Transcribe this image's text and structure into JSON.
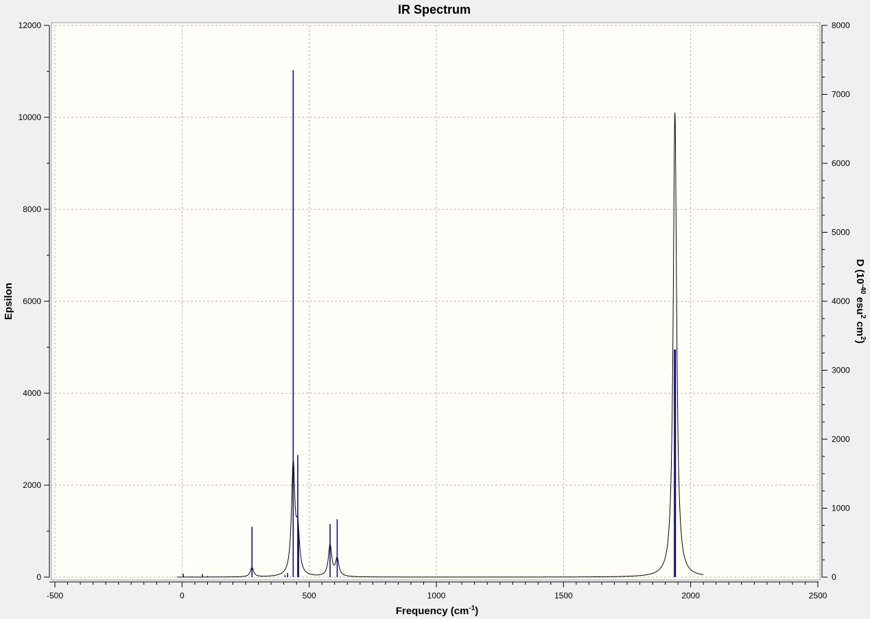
{
  "chart_data": {
    "type": "line",
    "title": "IR Spectrum",
    "xlabel": {
      "main": "Frequency (cm",
      "sup": "-1",
      "tail": ")"
    },
    "ylabel_left": "Epsilon",
    "ylabel_right": {
      "t1": "D (10",
      "s1": "-40",
      "t2": " esu",
      "s2": "2",
      "t3": " cm",
      "s3": "2",
      "t4": ")"
    },
    "xlim": [
      -500,
      2500
    ],
    "ylim_left": [
      0,
      12000
    ],
    "ylim_right": [
      0,
      8000
    ],
    "x_ticks": [
      -500,
      0,
      500,
      1000,
      1500,
      2000,
      2500
    ],
    "y_left_ticks": [
      0,
      2000,
      4000,
      6000,
      8000,
      10000,
      12000
    ],
    "y_right_ticks": [
      0,
      1000,
      2000,
      3000,
      4000,
      5000,
      6000,
      7000,
      8000
    ],
    "grid": true,
    "spectrum_range": [
      -20,
      2050
    ],
    "spectrum_hwhm": 8,
    "series": [
      {
        "kind": "bars",
        "axis": "right",
        "color": "#00007f",
        "points": [
          {
            "x": 5,
            "y": 50
          },
          {
            "x": 40,
            "y": 10
          },
          {
            "x": 80,
            "y": 45
          },
          {
            "x": 100,
            "y": 15
          },
          {
            "x": 120,
            "y": 8
          },
          {
            "x": 275,
            "y": 730
          },
          {
            "x": 405,
            "y": 30
          },
          {
            "x": 415,
            "y": 60
          },
          {
            "x": 437,
            "y": 7350
          },
          {
            "x": 455,
            "y": 1770
          },
          {
            "x": 458,
            "y": 700
          },
          {
            "x": 582,
            "y": 770
          },
          {
            "x": 610,
            "y": 840
          },
          {
            "x": 1936,
            "y": 3300
          },
          {
            "x": 1940,
            "y": 3300
          }
        ]
      },
      {
        "kind": "curve",
        "axis": "left",
        "color": "#000000",
        "peaks": [
          {
            "x": 275,
            "y": 200
          },
          {
            "x": 437,
            "y": 2400
          },
          {
            "x": 455,
            "y": 900
          },
          {
            "x": 582,
            "y": 680
          },
          {
            "x": 610,
            "y": 380
          },
          {
            "x": 1938,
            "y": 10100
          }
        ]
      }
    ]
  }
}
